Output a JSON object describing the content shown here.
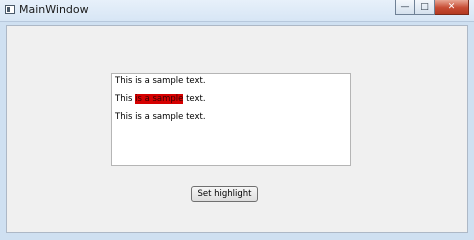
{
  "window": {
    "title": "MainWindow",
    "minimize": "—",
    "maximize": "□",
    "close": "✕"
  },
  "editor": {
    "line1": "This is a sample text.",
    "line2_before": "This ",
    "line2_highlight": "is a sample",
    "line2_after": " text.",
    "line3": "This is a sample text."
  },
  "highlight_color": "#d60000",
  "button": {
    "label": "Set highlight"
  }
}
